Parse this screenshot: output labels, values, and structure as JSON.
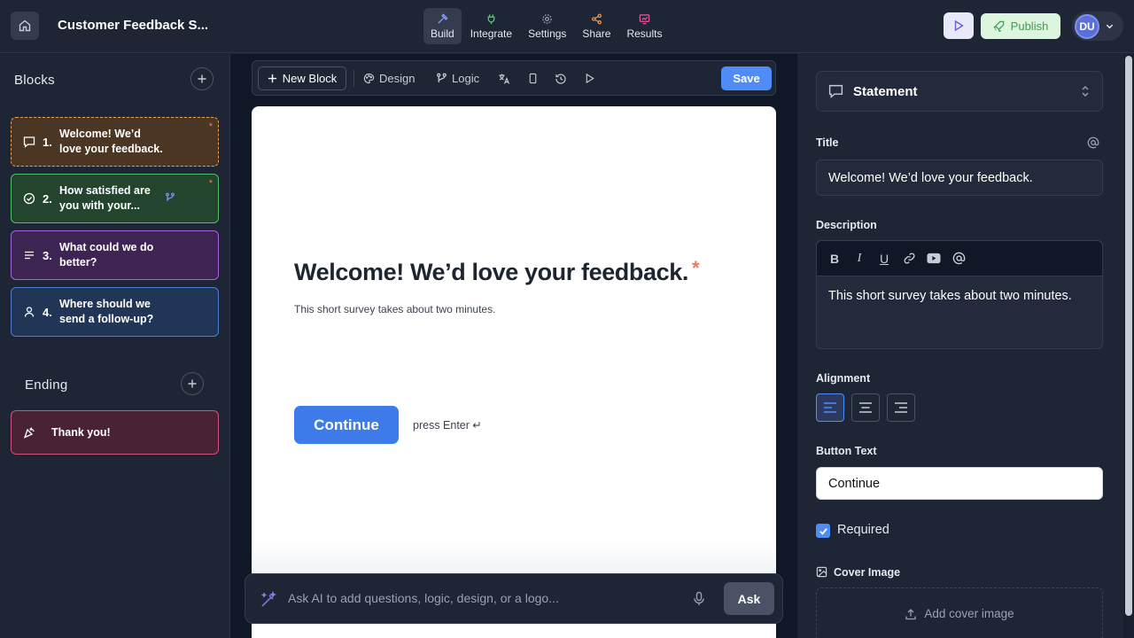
{
  "header": {
    "title": "Customer Feedback S...",
    "nav": [
      {
        "label": "Build",
        "icon": "hammer-icon",
        "color": "#8b9cf8"
      },
      {
        "label": "Integrate",
        "icon": "plug-icon",
        "color": "#58c77a"
      },
      {
        "label": "Settings",
        "icon": "gear-icon",
        "color": "#9aa2b1"
      },
      {
        "label": "Share",
        "icon": "share-icon",
        "color": "#f0a050"
      },
      {
        "label": "Results",
        "icon": "chart-icon",
        "color": "#e65c9c"
      }
    ],
    "publish_label": "Publish",
    "avatar_initials": "DU"
  },
  "sidebar": {
    "blocks_heading": "Blocks",
    "blocks": [
      {
        "num": "1.",
        "text": "Welcome! We’d love your feedback.",
        "icon": "speech-bubble-icon",
        "required": true,
        "bg": "#4a3622",
        "border": "#e8a35c"
      },
      {
        "num": "2.",
        "text": "How satisfied are you with your...",
        "icon": "check-circle-icon",
        "required": true,
        "bg": "#23452d",
        "border": "#4fbf6b"
      },
      {
        "num": "3.",
        "text": "What could we do better?",
        "icon": "text-lines-icon",
        "required": false,
        "bg": "#3d2453",
        "border": "#a463d8"
      },
      {
        "num": "4.",
        "text": "Where should we send a follow-up?",
        "icon": "person-icon",
        "required": false,
        "bg": "#213656",
        "border": "#4f7ed0"
      }
    ],
    "required_mark": "*",
    "ending_heading": "Ending",
    "ending": {
      "text": "Thank you!",
      "icon": "party-icon",
      "bg": "#4a2236",
      "border": "#d0527f"
    }
  },
  "toolbar": {
    "new_block_label": "New Block",
    "design_label": "Design",
    "logic_label": "Logic",
    "save_label": "Save"
  },
  "preview": {
    "title": "Welcome! We’d love your feedback.",
    "required_mark": "*",
    "description": "This short survey takes about two minutes.",
    "button_label": "Continue",
    "hint": "press Enter ↵"
  },
  "ai": {
    "placeholder": "Ask AI to add questions, logic, design, or a logo...",
    "ask_label": "Ask"
  },
  "panel": {
    "type_label": "Statement",
    "title_label": "Title",
    "title_value": "Welcome! We’d love your feedback.",
    "description_label": "Description",
    "description_value": "This short survey takes about two minutes.",
    "alignment_label": "Alignment",
    "button_text_label": "Button Text",
    "button_text_value": "Continue",
    "required_label": "Required",
    "required_checked": true,
    "cover_image_label": "Cover Image",
    "add_cover_label": "Add cover image"
  }
}
